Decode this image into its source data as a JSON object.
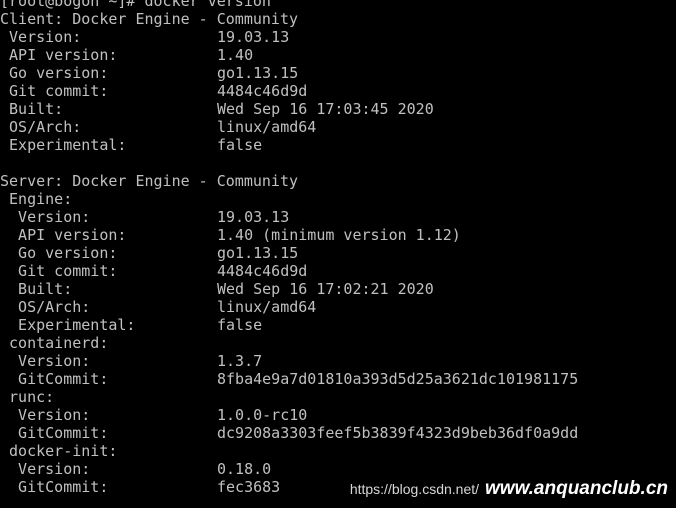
{
  "terminal": {
    "background": "#000000",
    "foreground": "#c0c0c0",
    "prompt": "[root@bogon ~]# docker version",
    "client_header": "Client: Docker Engine - Community",
    "client": [
      {
        "key": " Version:",
        "value": "19.03.13"
      },
      {
        "key": " API version:",
        "value": "1.40"
      },
      {
        "key": " Go version:",
        "value": "go1.13.15"
      },
      {
        "key": " Git commit:",
        "value": "4484c46d9d"
      },
      {
        "key": " Built:",
        "value": "Wed Sep 16 17:03:45 2020"
      },
      {
        "key": " OS/Arch:",
        "value": "linux/amd64"
      },
      {
        "key": " Experimental:",
        "value": "false"
      }
    ],
    "server_header": "Server: Docker Engine - Community",
    "engine_label": " Engine:",
    "engine": [
      {
        "key": "  Version:",
        "value": "19.03.13"
      },
      {
        "key": "  API version:",
        "value": "1.40 (minimum version 1.12)"
      },
      {
        "key": "  Go version:",
        "value": "go1.13.15"
      },
      {
        "key": "  Git commit:",
        "value": "4484c46d9d"
      },
      {
        "key": "  Built:",
        "value": "Wed Sep 16 17:02:21 2020"
      },
      {
        "key": "  OS/Arch:",
        "value": "linux/amd64"
      },
      {
        "key": "  Experimental:",
        "value": "false"
      }
    ],
    "containerd_label": " containerd:",
    "containerd": [
      {
        "key": "  Version:",
        "value": "1.3.7"
      },
      {
        "key": "  GitCommit:",
        "value": "8fba4e9a7d01810a393d5d25a3621dc101981175"
      }
    ],
    "runc_label": " runc:",
    "runc": [
      {
        "key": "  Version:",
        "value": "1.0.0-rc10"
      },
      {
        "key": "  GitCommit:",
        "value": "dc9208a3303feef5b3839f4323d9beb36df0a9dd"
      }
    ],
    "docker_init_label": " docker-init:",
    "docker_init": [
      {
        "key": "  Version:",
        "value": "0.18.0"
      },
      {
        "key": "  GitCommit:",
        "value": "fec3683"
      }
    ]
  },
  "watermark": {
    "url": "https://blog.csdn.net/",
    "logo": "www.anquanclub.cn"
  }
}
